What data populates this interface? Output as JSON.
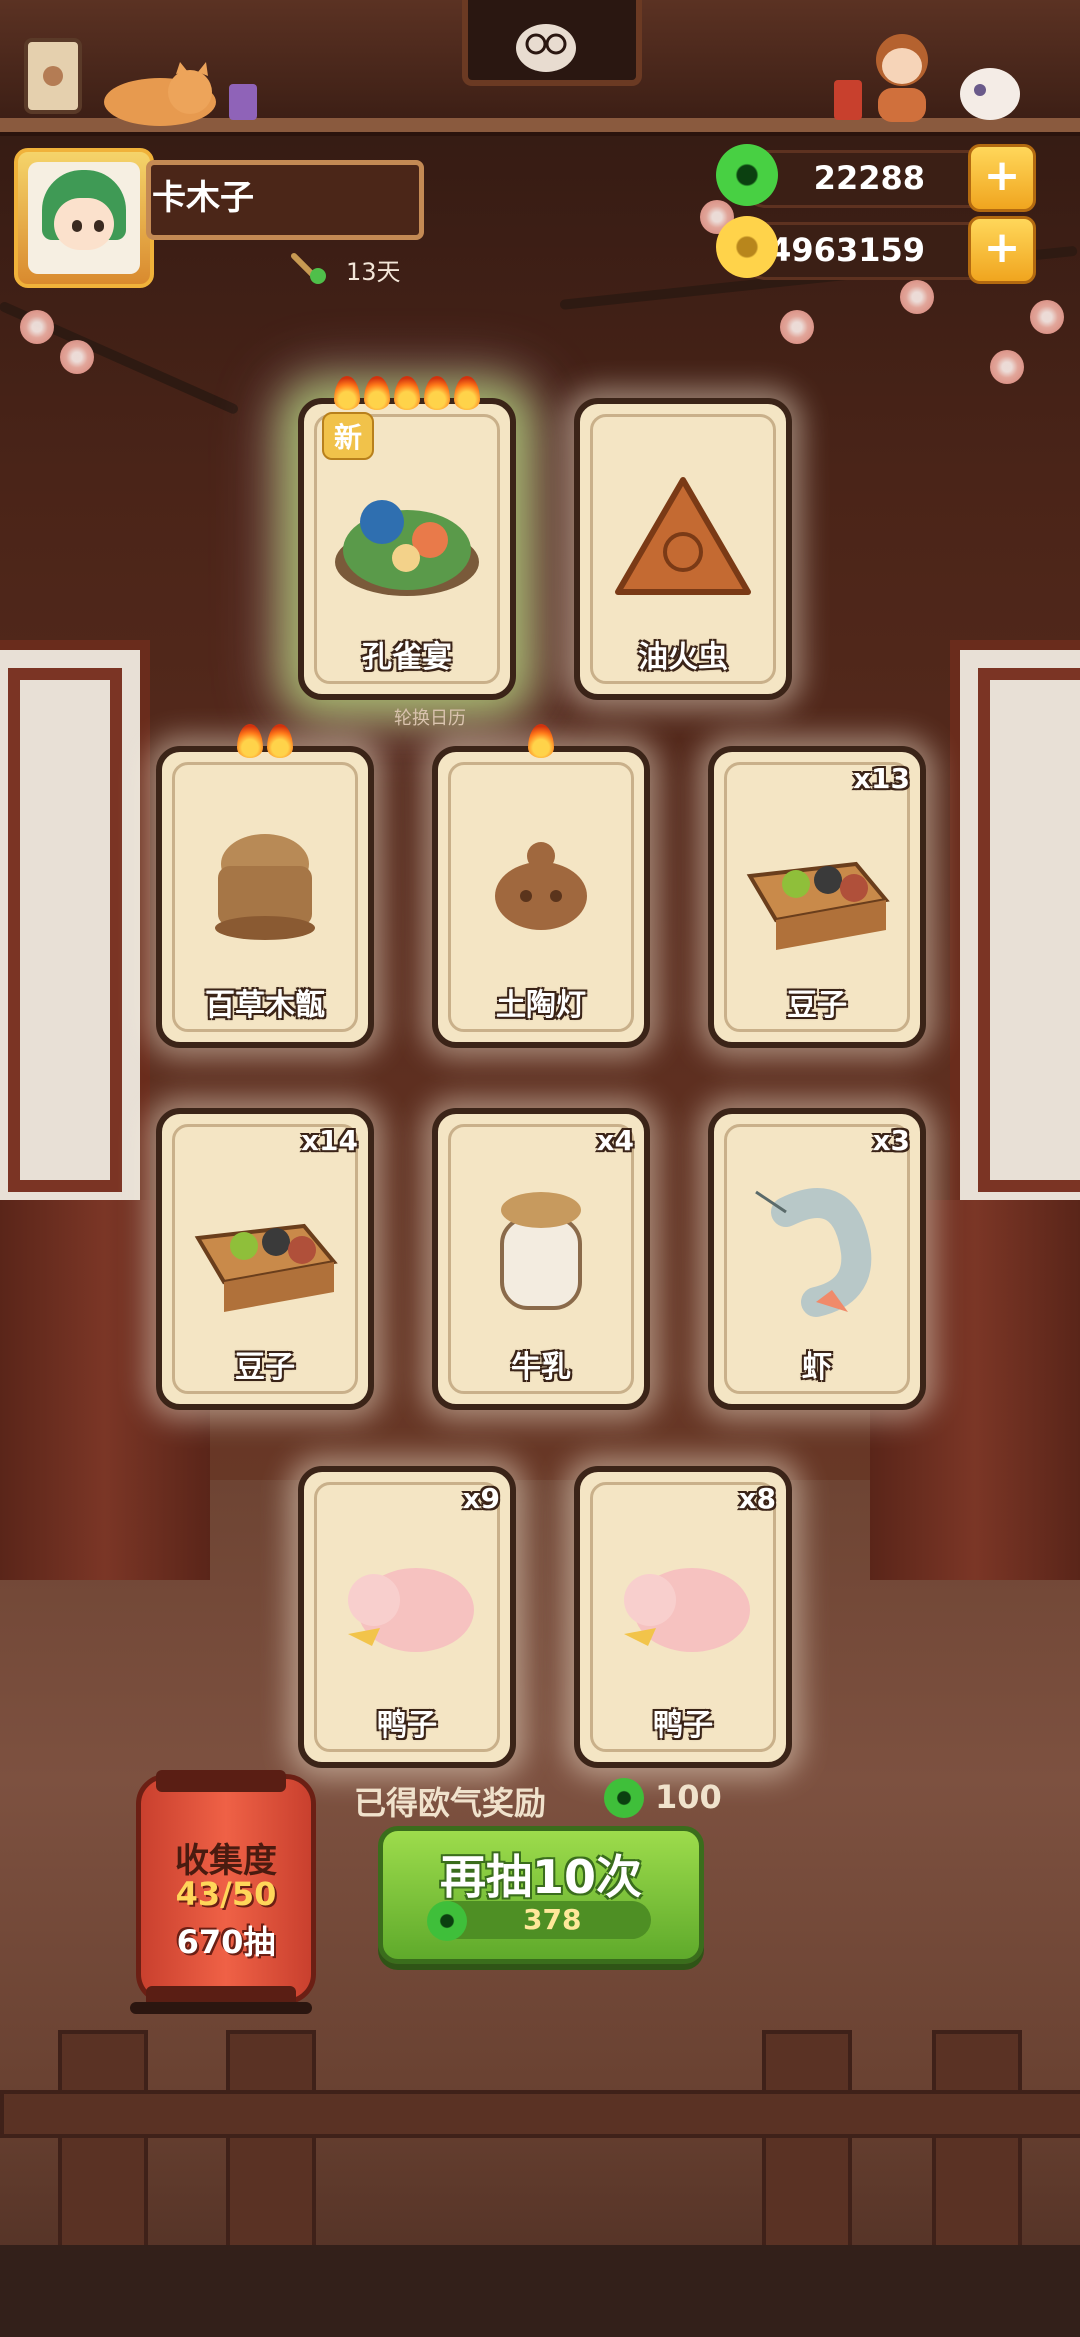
{
  "player": {
    "name": "卡木子",
    "days": "13天"
  },
  "currency": {
    "jade": "22288",
    "coins": "4963159"
  },
  "calendar_label": "轮换日历",
  "new_badge": "新",
  "cards": [
    {
      "name": "孔雀宴",
      "count": "",
      "flames": 5,
      "is_new": true
    },
    {
      "name": "油火虫",
      "count": "",
      "flames": 0,
      "is_new": false
    },
    {
      "name": "百草木甑",
      "count": "",
      "flames": 2,
      "is_new": false
    },
    {
      "name": "土陶灯",
      "count": "",
      "flames": 1,
      "is_new": false
    },
    {
      "name": "豆子",
      "count": "x13",
      "flames": 0,
      "is_new": false
    },
    {
      "name": "豆子",
      "count": "x14",
      "flames": 0,
      "is_new": false
    },
    {
      "name": "牛乳",
      "count": "x4",
      "flames": 0,
      "is_new": false
    },
    {
      "name": "虾",
      "count": "x3",
      "flames": 0,
      "is_new": false
    },
    {
      "name": "鸭子",
      "count": "x9",
      "flames": 0,
      "is_new": false
    },
    {
      "name": "鸭子",
      "count": "x8",
      "flames": 0,
      "is_new": false
    }
  ],
  "reward": {
    "label": "已得欧气奖励",
    "value": "100"
  },
  "draw_button": {
    "label": "再抽10次",
    "cost": "378"
  },
  "collection": {
    "title": "收集度",
    "progress": "43/50",
    "draws": "670抽"
  }
}
